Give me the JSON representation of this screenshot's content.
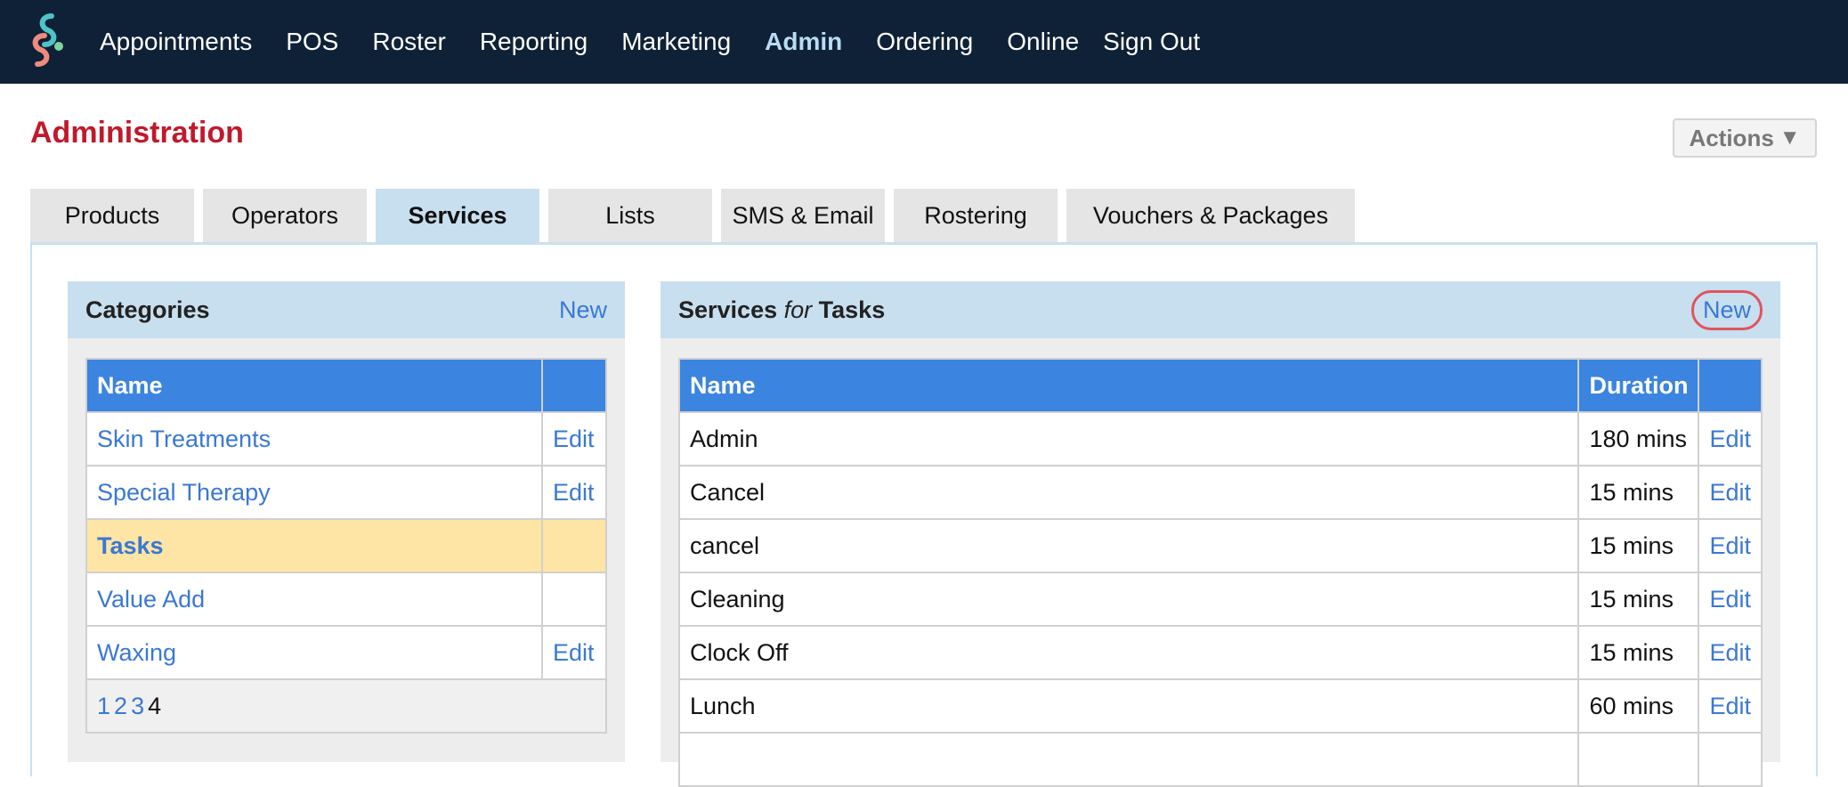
{
  "nav": {
    "items": [
      "Appointments",
      "POS",
      "Roster",
      "Reporting",
      "Marketing",
      "Admin",
      "Ordering",
      "Online",
      "Sign Out"
    ],
    "active": "Admin"
  },
  "header": {
    "title": "Administration",
    "actions_label": "Actions"
  },
  "tabs": [
    "Products",
    "Operators",
    "Services",
    "Lists",
    "SMS & Email",
    "Rostering",
    "Vouchers & Packages"
  ],
  "active_tab": "Services",
  "categories": {
    "title": "Categories",
    "new_label": "New",
    "col_name": "Name",
    "rows": [
      {
        "name": "Skin Treatments",
        "edit": "Edit"
      },
      {
        "name": "Special Therapy",
        "edit": "Edit"
      },
      {
        "name": "Tasks",
        "edit": ""
      },
      {
        "name": "Value Add",
        "edit": ""
      },
      {
        "name": "Waxing",
        "edit": "Edit"
      }
    ],
    "pages": [
      "1",
      "2",
      "3",
      "4"
    ],
    "current_page": "4"
  },
  "services": {
    "title_prefix": "Services",
    "title_for": "for",
    "title_category": "Tasks",
    "new_label": "New",
    "col_name": "Name",
    "col_duration": "Duration",
    "rows": [
      {
        "name": "Admin",
        "duration": "180 mins",
        "edit": "Edit"
      },
      {
        "name": "Cancel",
        "duration": "15 mins",
        "edit": "Edit"
      },
      {
        "name": "cancel",
        "duration": "15 mins",
        "edit": "Edit"
      },
      {
        "name": "Cleaning",
        "duration": "15 mins",
        "edit": "Edit"
      },
      {
        "name": "Clock Off",
        "duration": "15 mins",
        "edit": "Edit"
      },
      {
        "name": "Lunch",
        "duration": "60 mins",
        "edit": "Edit"
      }
    ]
  },
  "colors": {
    "nav_bg": "#0f2136",
    "title_red": "#c0192c",
    "link_blue": "#3a78d4",
    "table_header": "#3b84e0",
    "panel_header": "#c8dff0",
    "selected_row": "#fee5a5",
    "highlight_circle": "#e0555e"
  }
}
